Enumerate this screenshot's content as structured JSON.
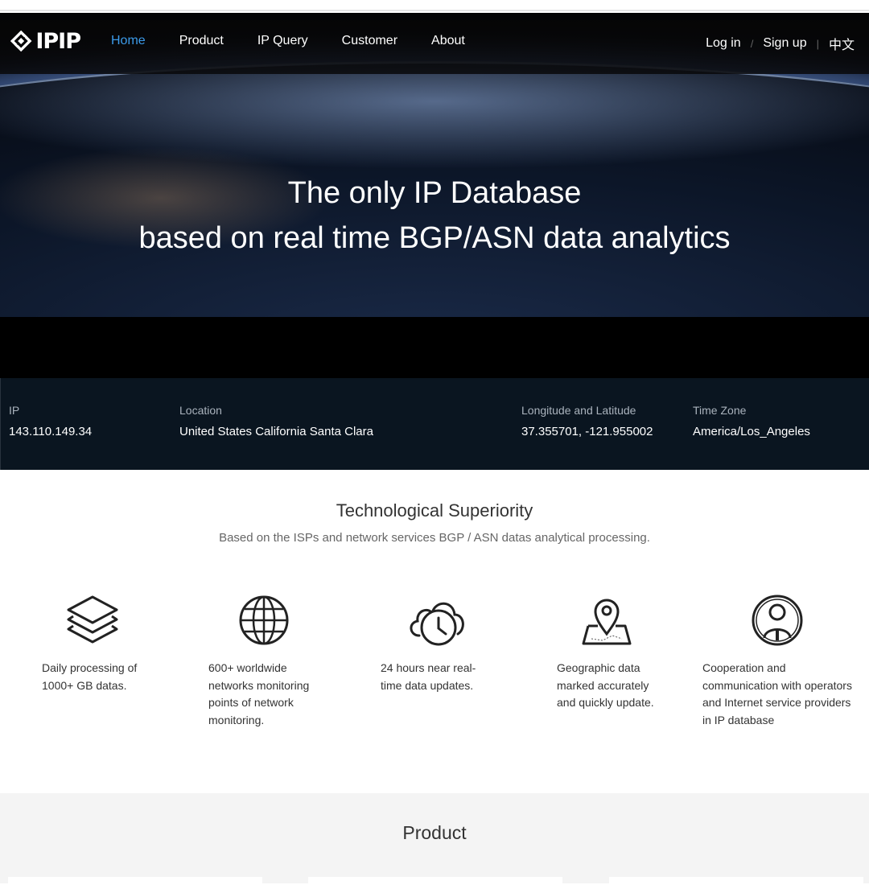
{
  "brand": {
    "name": "IPIP"
  },
  "nav": {
    "items": [
      "Home",
      "Product",
      "IP Query",
      "Customer",
      "About"
    ],
    "active": "Home",
    "login": "Log in",
    "signup": "Sign up",
    "lang": "中文",
    "separator": "/"
  },
  "hero": {
    "line1": "The only IP Database",
    "line2": "based on real time BGP/ASN data analytics"
  },
  "ip_info": {
    "ip_label": "IP",
    "ip_value": "143.110.149.34",
    "location_label": "Location",
    "location_value": "United States California Santa Clara",
    "lonlat_label": "Longitude and Latitude",
    "lonlat_value": "37.355701, -121.955002",
    "tz_label": "Time Zone",
    "tz_value": "America/Los_Angeles"
  },
  "tech": {
    "title": "Technological Superiority",
    "subtitle": "Based on the ISPs and network services BGP / ASN datas analytical processing.",
    "features": [
      {
        "icon": "layers-icon",
        "text": "Daily processing of 1000+ GB datas."
      },
      {
        "icon": "globe-icon",
        "text": "600+ worldwide networks monitoring points of network monitoring."
      },
      {
        "icon": "cloud-clock-icon",
        "text": "24 hours near real-time data updates."
      },
      {
        "icon": "map-pin-icon",
        "text": "Geographic data marked accurately and quickly update."
      },
      {
        "icon": "user-circle-icon",
        "text": "Cooperation and communication with operators and Internet service providers in IP database"
      }
    ]
  },
  "product": {
    "title": "Product"
  },
  "colors": {
    "accent": "#3c9bea",
    "ipbar_bg": "#0a1520"
  }
}
